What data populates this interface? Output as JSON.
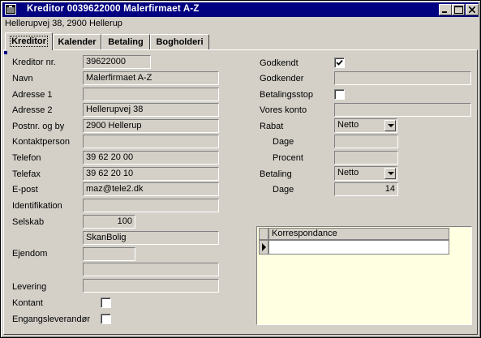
{
  "window": {
    "title": "Kreditor  0039622000 Malerfirmaet A-Z",
    "subtitle": "Hellerupvej 38, 2900 Hellerup"
  },
  "tabs": [
    {
      "label": "Kreditor",
      "active": true
    },
    {
      "label": "Kalender",
      "active": false
    },
    {
      "label": "Betaling",
      "active": false
    },
    {
      "label": "Bogholderi",
      "active": false
    }
  ],
  "left_form": {
    "kreditor_nr": {
      "label": "Kreditor nr.",
      "value": "39622000"
    },
    "navn": {
      "label": "Navn",
      "value": "Malerfirmaet A-Z"
    },
    "adresse1": {
      "label": "Adresse 1",
      "value": ""
    },
    "adresse2": {
      "label": "Adresse 2",
      "value": "Hellerupvej 38"
    },
    "postnr": {
      "label": "Postnr. og by",
      "value": "2900 Hellerup"
    },
    "kontaktperson": {
      "label": "Kontaktperson",
      "value": ""
    },
    "telefon": {
      "label": "Telefon",
      "value": "39 62 20 00"
    },
    "telefax": {
      "label": "Telefax",
      "value": "39 62 20 10"
    },
    "epost": {
      "label": "E-post",
      "value": "maz@tele2.dk"
    },
    "identifikation": {
      "label": "Identifikation",
      "value": ""
    },
    "selskab": {
      "label": "Selskab",
      "value": "100",
      "name": "SkanBolig"
    },
    "ejendom": {
      "label": "Ejendom",
      "value": "",
      "name": ""
    },
    "levering": {
      "label": "Levering",
      "value": ""
    },
    "kontant": {
      "label": "Kontant",
      "checked": false
    },
    "engangsleverandor": {
      "label": "Engangsleverandør",
      "checked": false
    }
  },
  "right_form": {
    "godkendt": {
      "label": "Godkendt",
      "checked": true
    },
    "godkender": {
      "label": "Godkender",
      "value": ""
    },
    "betalingsstop": {
      "label": "Betalingsstop",
      "checked": false
    },
    "vores_konto": {
      "label": "Vores konto",
      "value": ""
    },
    "rabat": {
      "label": "Rabat",
      "value": "Netto"
    },
    "rabat_dage": {
      "label": "Dage",
      "value": ""
    },
    "rabat_procent": {
      "label": "Procent",
      "value": ""
    },
    "betaling": {
      "label": "Betaling",
      "value": "Netto"
    },
    "betaling_dage": {
      "label": "Dage",
      "value": "14"
    }
  },
  "grid": {
    "column_header": "Korrespondance"
  },
  "colors": {
    "titlebar": "#000080",
    "face": "#d4d0c8",
    "grid_background": "#ffffe1"
  }
}
